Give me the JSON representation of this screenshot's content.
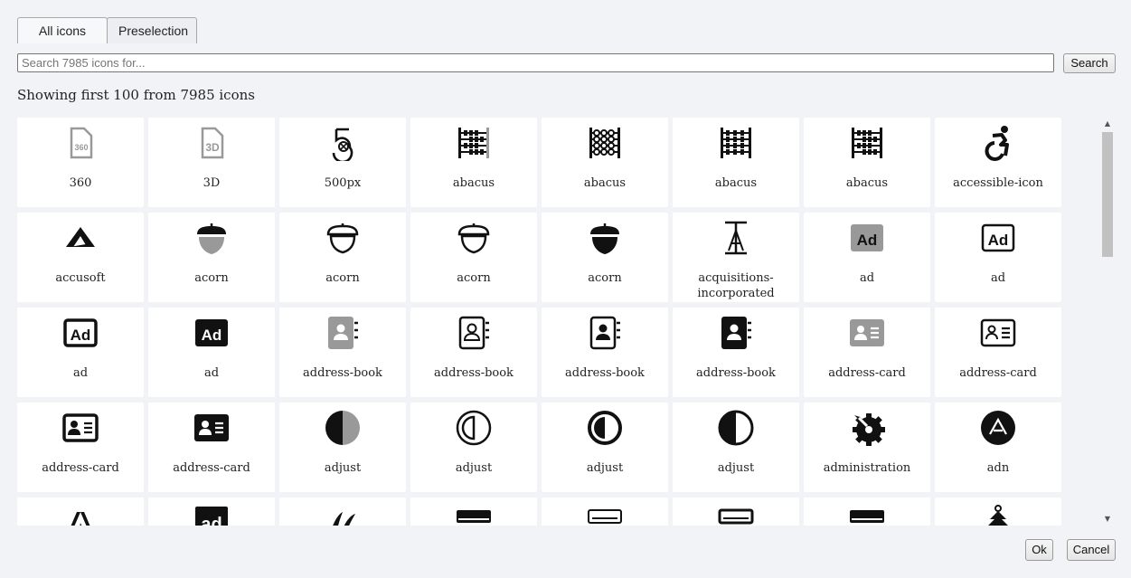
{
  "tabs": [
    {
      "label": "All icons"
    },
    {
      "label": "Preselection"
    }
  ],
  "search": {
    "placeholder": "Search 7985 icons for...",
    "value": "",
    "button_label": "Search"
  },
  "summary_text": "Showing first 100 from 7985 icons",
  "icons": [
    {
      "label": "360",
      "icon": "file-360-icon"
    },
    {
      "label": "3D",
      "icon": "file-3d-icon"
    },
    {
      "label": "500px",
      "icon": "500px-icon"
    },
    {
      "label": "abacus",
      "icon": "abacus-icon"
    },
    {
      "label": "abacus",
      "icon": "abacus-icon"
    },
    {
      "label": "abacus",
      "icon": "abacus-icon"
    },
    {
      "label": "abacus",
      "icon": "abacus-icon"
    },
    {
      "label": "accessible-icon",
      "icon": "wheelchair-icon"
    },
    {
      "label": "accusoft",
      "icon": "accusoft-icon"
    },
    {
      "label": "acorn",
      "icon": "acorn-icon"
    },
    {
      "label": "acorn",
      "icon": "acorn-icon"
    },
    {
      "label": "acorn",
      "icon": "acorn-icon"
    },
    {
      "label": "acorn",
      "icon": "acorn-icon"
    },
    {
      "label": "acquisitions-incorporated",
      "icon": "acquisitions-incorporated-icon"
    },
    {
      "label": "ad",
      "icon": "ad-icon"
    },
    {
      "label": "ad",
      "icon": "ad-icon"
    },
    {
      "label": "ad",
      "icon": "ad-icon"
    },
    {
      "label": "ad",
      "icon": "ad-icon"
    },
    {
      "label": "address-book",
      "icon": "address-book-icon"
    },
    {
      "label": "address-book",
      "icon": "address-book-icon"
    },
    {
      "label": "address-book",
      "icon": "address-book-icon"
    },
    {
      "label": "address-book",
      "icon": "address-book-icon"
    },
    {
      "label": "address-card",
      "icon": "address-card-icon"
    },
    {
      "label": "address-card",
      "icon": "address-card-icon"
    },
    {
      "label": "address-card",
      "icon": "address-card-icon"
    },
    {
      "label": "address-card",
      "icon": "address-card-icon"
    },
    {
      "label": "adjust",
      "icon": "adjust-icon"
    },
    {
      "label": "adjust",
      "icon": "adjust-icon"
    },
    {
      "label": "adjust",
      "icon": "adjust-icon"
    },
    {
      "label": "adjust",
      "icon": "adjust-icon"
    },
    {
      "label": "administration",
      "icon": "administration-icon"
    },
    {
      "label": "adn",
      "icon": "adn-icon"
    },
    {
      "label": "",
      "icon": "adobe-icon"
    },
    {
      "label": "",
      "icon": "adversal-icon"
    },
    {
      "label": "",
      "icon": "affiliatetheme-icon"
    },
    {
      "label": "",
      "icon": "air-conditioner-icon"
    },
    {
      "label": "",
      "icon": "air-conditioner-icon"
    },
    {
      "label": "",
      "icon": "air-conditioner-icon"
    },
    {
      "label": "",
      "icon": "air-conditioner-icon"
    },
    {
      "label": "",
      "icon": "air-freshener-icon"
    }
  ],
  "buttons": {
    "ok": "Ok",
    "cancel": "Cancel"
  },
  "colors": {
    "background": "#f1f3f6",
    "card": "#ffffff",
    "icon_dark": "#111111",
    "icon_gray": "#999999"
  }
}
